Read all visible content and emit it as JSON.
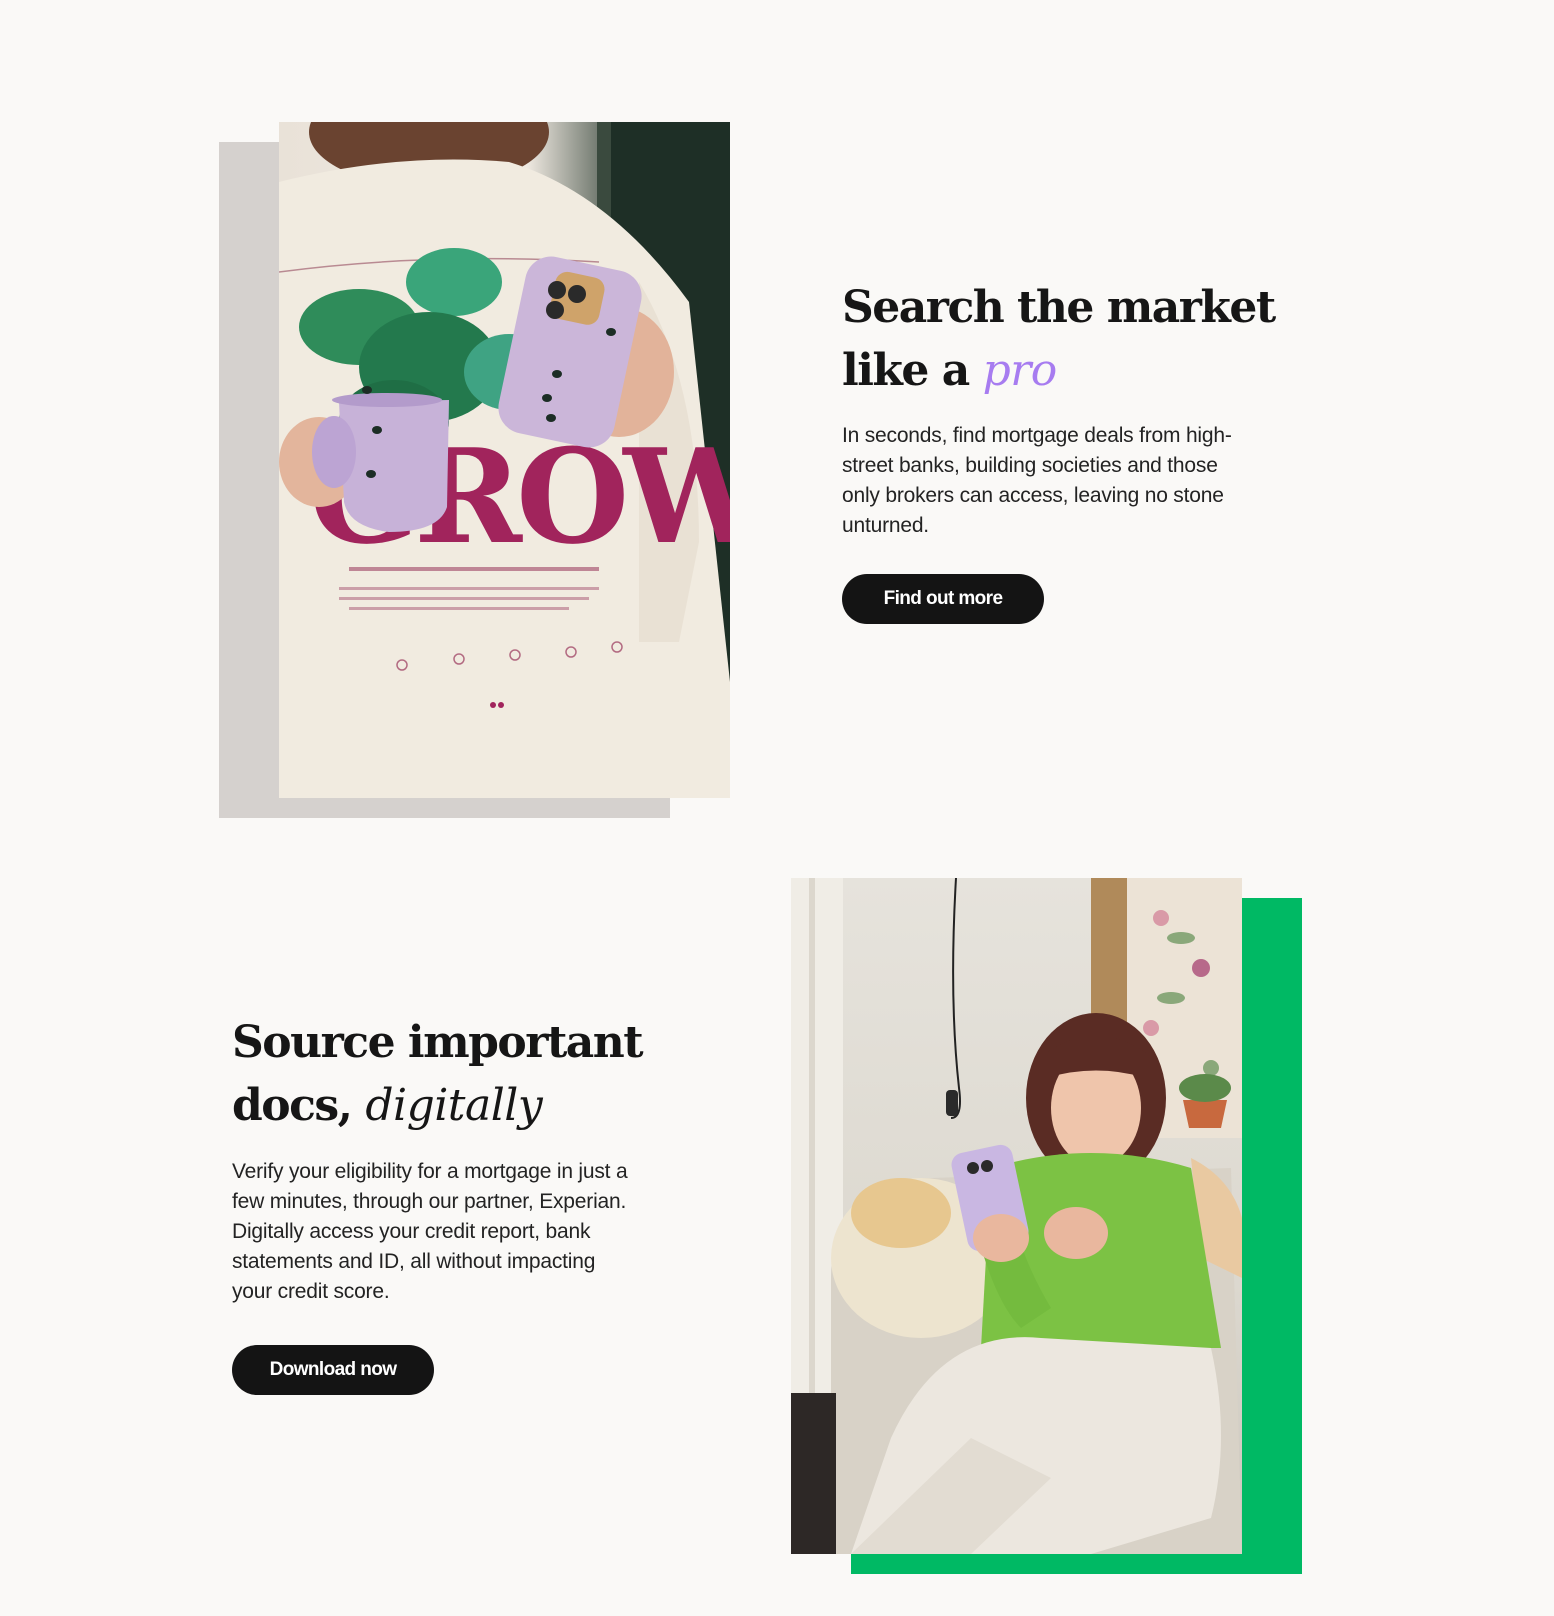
{
  "features": [
    {
      "id": "search",
      "heading_line1": "Search the market",
      "heading_line2_prefix": "like a",
      "heading_accent": "pro",
      "accent_color": "#a77cf0",
      "body": "In seconds, find mortgage deals from high-street banks, building societies and those only brokers can access, leaving no stone unturned.",
      "cta_label": "Find out more",
      "photo": "woman-holding-mug-and-phone-photo",
      "backdrop_color": "#d5d1ce"
    },
    {
      "id": "docs",
      "heading_line1": "Source important",
      "heading_line2_prefix": "docs,",
      "heading_accent": "digitally",
      "accent_color": "#161616",
      "body": "Verify your eligibility for a mortgage in just a few minutes, through our partner, Experian. Digitally access your credit report, bank statements and ID, all without impacting your credit score.",
      "cta_label": "Download now",
      "photo": "woman-on-sofa-with-phone-photo",
      "backdrop_color": "#00b964"
    }
  ],
  "colors": {
    "page_background": "#faf9f7",
    "button_background": "#141414",
    "button_text": "#ffffff",
    "text": "#161616"
  }
}
